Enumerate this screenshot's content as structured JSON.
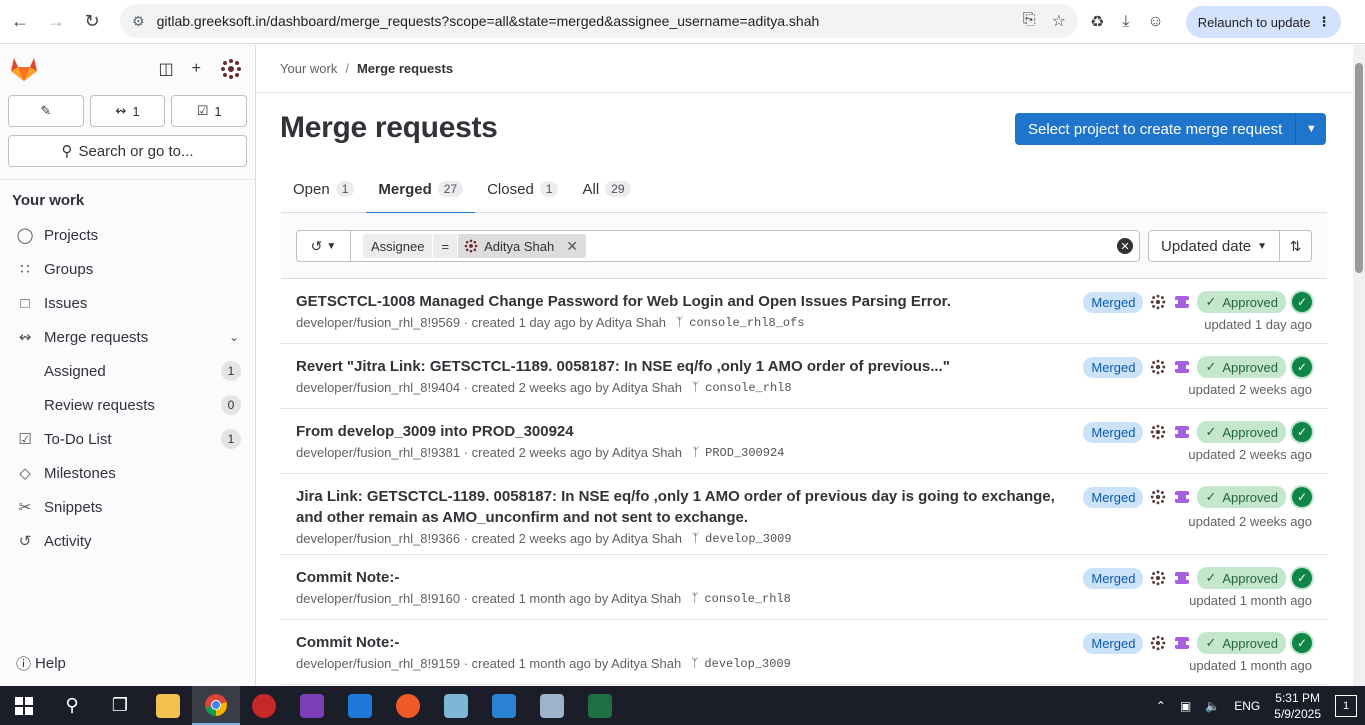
{
  "browser": {
    "url": "gitlab.greeksoft.in/dashboard/merge_requests?scope=all&state=merged&assignee_username=aditya.shah",
    "relaunch_label": "Relaunch to update"
  },
  "sidebar": {
    "counts": {
      "mr": "1",
      "todo": "1"
    },
    "search_label": "Search or go to...",
    "section_title": "Your work",
    "items": [
      {
        "label": "Projects"
      },
      {
        "label": "Groups"
      },
      {
        "label": "Issues"
      },
      {
        "label": "Merge requests"
      },
      {
        "label": "To-Do List",
        "count": "1"
      },
      {
        "label": "Milestones"
      },
      {
        "label": "Snippets"
      },
      {
        "label": "Activity"
      }
    ],
    "sub_items": [
      {
        "label": "Assigned",
        "count": "1"
      },
      {
        "label": "Review requests",
        "count": "0"
      }
    ],
    "help_label": "Help"
  },
  "breadcrumb": {
    "parent": "Your work",
    "current": "Merge requests"
  },
  "page": {
    "title": "Merge requests",
    "create_button": "Select project to create merge request"
  },
  "tabs": [
    {
      "label": "Open",
      "count": "1"
    },
    {
      "label": "Merged",
      "count": "27"
    },
    {
      "label": "Closed",
      "count": "1"
    },
    {
      "label": "All",
      "count": "29"
    }
  ],
  "filter": {
    "token_key": "Assignee",
    "token_op": "=",
    "token_value": "Aditya Shah",
    "sort_label": "Updated date"
  },
  "status": {
    "merged": "Merged",
    "approved": "Approved"
  },
  "merge_requests": [
    {
      "title": "GETSCTCL-1008 Managed Change Password for Web Login and Open Issues Parsing Error.",
      "meta": "developer/fusion_rhl_8!9569 · created 1 day ago by Aditya Shah",
      "branch": "console_rhl8_ofs",
      "updated": "updated 1 day ago"
    },
    {
      "title": "Revert \"Jitra Link: GETSCTCL-1189. 0058187: In NSE eq/fo ,only 1 AMO order of previous...\"",
      "meta": "developer/fusion_rhl_8!9404 · created 2 weeks ago by Aditya Shah",
      "branch": "console_rhl8",
      "updated": "updated 2 weeks ago"
    },
    {
      "title": "From develop_3009 into PROD_300924",
      "meta": "developer/fusion_rhl_8!9381 · created 2 weeks ago by Aditya Shah",
      "branch": "PROD_300924",
      "updated": "updated 2 weeks ago"
    },
    {
      "title": "Jira Link: GETSCTCL-1189. 0058187: In NSE eq/fo ,only 1 AMO order of previous day is going to exchange, and other remain as AMO_unconfirm and not sent to exchange.",
      "meta": "developer/fusion_rhl_8!9366 · created 2 weeks ago by Aditya Shah",
      "branch": "develop_3009",
      "updated": "updated 2 weeks ago"
    },
    {
      "title": "Commit Note:-",
      "meta": "developer/fusion_rhl_8!9160 · created 1 month ago by Aditya Shah",
      "branch": "console_rhl8",
      "updated": "updated 1 month ago"
    },
    {
      "title": "Commit Note:-",
      "meta": "developer/fusion_rhl_8!9159 · created 1 month ago by Aditya Shah",
      "branch": "develop_3009",
      "updated": "updated 1 month ago"
    }
  ],
  "taskbar": {
    "time": "5:31 PM",
    "date": "5/9/2025",
    "lang": "ENG",
    "notifications": "1"
  }
}
